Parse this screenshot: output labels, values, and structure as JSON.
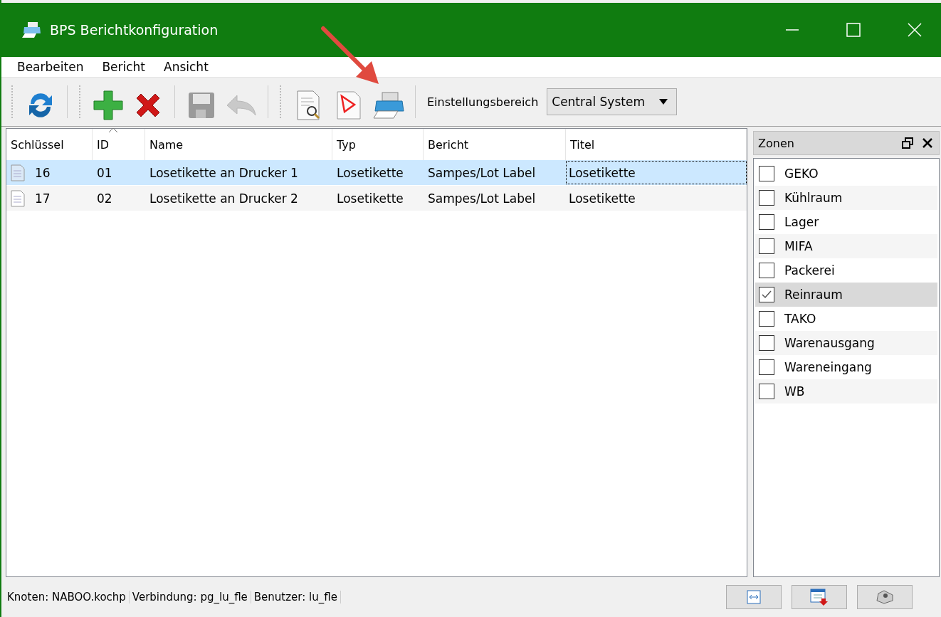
{
  "window": {
    "title": "BPS Berichtkonfiguration"
  },
  "menu": [
    "Bearbeiten",
    "Bericht",
    "Ansicht"
  ],
  "toolbar": {
    "buttons": [
      {
        "kind": "refresh",
        "disabled": false
      },
      {
        "kind": "add",
        "disabled": false
      },
      {
        "kind": "delete",
        "disabled": false
      },
      {
        "kind": "save",
        "disabled": true
      },
      {
        "kind": "undo",
        "disabled": true
      },
      {
        "kind": "preview",
        "disabled": false
      },
      {
        "kind": "pdf",
        "disabled": false
      },
      {
        "kind": "print",
        "disabled": false
      }
    ],
    "scope_label": "Einstellungsbereich",
    "scope_value": "Central System"
  },
  "table": {
    "columns": [
      "Schlüssel",
      "ID",
      "Name",
      "Typ",
      "Bericht",
      "Titel"
    ],
    "rows": [
      {
        "selected": true,
        "cells": [
          "16",
          "01",
          "Losetikette an Drucker 1",
          "Losetikette",
          "Sampes/Lot Label",
          "Losetikette"
        ]
      },
      {
        "selected": false,
        "cells": [
          "17",
          "02",
          "Losetikette an Drucker 2",
          "Losetikette",
          "Sampes/Lot Label",
          "Losetikette"
        ]
      }
    ]
  },
  "zones": {
    "title": "Zonen",
    "items": [
      {
        "label": "GEKO",
        "checked": false,
        "selected": false
      },
      {
        "label": "Kühlraum",
        "checked": false,
        "selected": false
      },
      {
        "label": "Lager",
        "checked": false,
        "selected": false
      },
      {
        "label": "MIFA",
        "checked": false,
        "selected": false
      },
      {
        "label": "Packerei",
        "checked": false,
        "selected": false
      },
      {
        "label": "Reinraum",
        "checked": true,
        "selected": true
      },
      {
        "label": "TAKO",
        "checked": false,
        "selected": false
      },
      {
        "label": "Warenausgang",
        "checked": false,
        "selected": false
      },
      {
        "label": "Wareneingang",
        "checked": false,
        "selected": false
      },
      {
        "label": "WB",
        "checked": false,
        "selected": false
      }
    ]
  },
  "status_bar": {
    "fields": [
      "Knoten: NABOO.kochp",
      "Verbindung: pg_lu_fle",
      "Benutzer: lu_fle"
    ],
    "buttons": [
      {
        "kind": "fit"
      },
      {
        "kind": "export"
      },
      {
        "kind": "tape"
      }
    ]
  }
}
